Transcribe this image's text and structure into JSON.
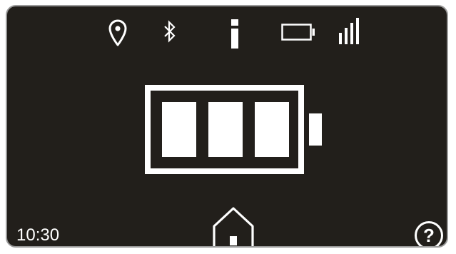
{
  "status_bar": {
    "icons": [
      "location-pin-icon",
      "bluetooth-icon",
      "info-icon",
      "battery-outline-icon",
      "signal-bars-icon"
    ]
  },
  "battery_display": {
    "icon": "battery-full-icon",
    "segments_filled": 3,
    "segments_total": 3
  },
  "footer": {
    "time": "10:30",
    "home_icon": "home-icon",
    "help_label": "?"
  },
  "colors": {
    "screen_background": "#221f1b",
    "foreground": "#ffffff",
    "frame": "#9a9a9a"
  }
}
